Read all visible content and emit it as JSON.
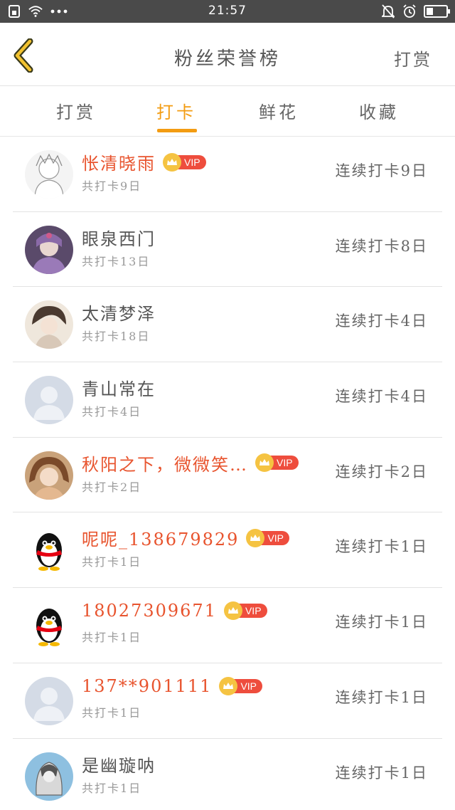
{
  "status_bar": {
    "time": "21:57"
  },
  "header": {
    "title": "粉丝荣誉榜",
    "right_action": "打赏"
  },
  "tabs": [
    {
      "label": "打赏"
    },
    {
      "label": "打卡"
    },
    {
      "label": "鲜花"
    },
    {
      "label": "收藏"
    }
  ],
  "colors": {
    "accent": "#f39c12",
    "vip_name": "#e8542e",
    "vip_badge": "#ee4d3d"
  },
  "vip_label": "VIP",
  "rows": [
    {
      "name": "怅清晓雨",
      "vip": true,
      "total": "共打卡9日",
      "streak": "连续打卡9日"
    },
    {
      "name": "眼泉西门",
      "vip": false,
      "total": "共打卡13日",
      "streak": "连续打卡8日"
    },
    {
      "name": "太清梦泽",
      "vip": false,
      "total": "共打卡18日",
      "streak": "连续打卡4日"
    },
    {
      "name": "青山常在",
      "vip": false,
      "total": "共打卡4日",
      "streak": "连续打卡4日"
    },
    {
      "name": "秋阳之下，微微笑…",
      "vip": true,
      "total": "共打卡2日",
      "streak": "连续打卡2日"
    },
    {
      "name": "呢呢_138679829",
      "vip": true,
      "total": "共打卡1日",
      "streak": "连续打卡1日"
    },
    {
      "name": "18027309671",
      "vip": true,
      "total": "共打卡1日",
      "streak": "连续打卡1日"
    },
    {
      "name": "137**901111",
      "vip": true,
      "total": "共打卡1日",
      "streak": "连续打卡1日"
    },
    {
      "name": "是幽璇呐",
      "vip": false,
      "total": "共打卡1日",
      "streak": "连续打卡1日"
    }
  ]
}
